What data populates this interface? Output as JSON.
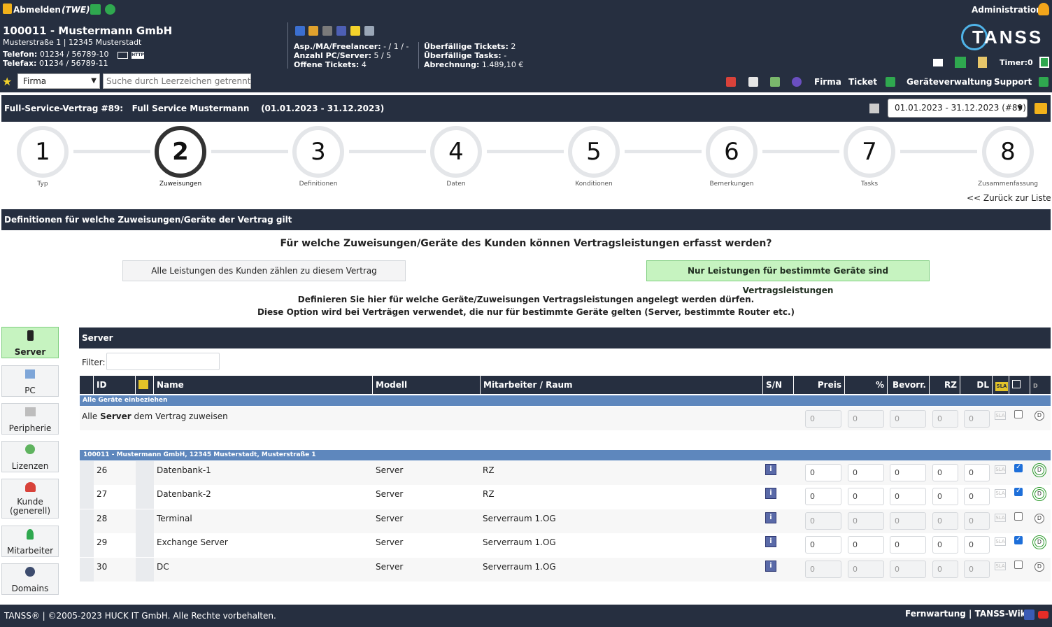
{
  "topbar": {
    "logout_label": "Abmelden",
    "user_short": "(TWE)",
    "admin_label": "Administration"
  },
  "customer": {
    "title": "100011 - Mustermann GmbH",
    "address": "Musterstraße 1 | 12345 Musterstadt",
    "phone_label": "Telefon:",
    "phone": "01234 / 56789-10",
    "fax_label": "Telefax:",
    "fax": "01234 / 56789-11",
    "asp_label": "Asp./MA/Freelancer:",
    "asp_value": "- / 1 / -",
    "pc_label": "Anzahl PC/Server:",
    "pc_value": "5 / 5",
    "tickets_label": "Offene Tickets:",
    "tickets_value": "4",
    "overdue_tickets_label": "Überfällige Tickets:",
    "overdue_tickets_value": "2",
    "overdue_tasks_label": "Überfällige Tasks:",
    "overdue_tasks_value": "-",
    "billing_label": "Abrechnung:",
    "billing_value": "1.489,10 €",
    "timer_label": "Timer:",
    "timer_value": "0",
    "logo_text": "TANSS"
  },
  "nav": {
    "select_value": "Firma",
    "search_placeholder": "Suche durch Leerzeichen getrennt",
    "menu": [
      "Firma",
      "Ticket",
      "Geräteverwaltung",
      "Support"
    ]
  },
  "contract": {
    "title": "Full-Service-Vertrag #89:   Full Service Mustermann    (01.01.2023 - 31.12.2023)",
    "period_select": "01.01.2023 - 31.12.2023 (#89)"
  },
  "steps": [
    {
      "num": "1",
      "label": "Typ"
    },
    {
      "num": "2",
      "label": "Zuweisungen"
    },
    {
      "num": "3",
      "label": "Definitionen"
    },
    {
      "num": "4",
      "label": "Daten"
    },
    {
      "num": "5",
      "label": "Konditionen"
    },
    {
      "num": "6",
      "label": "Bemerkungen"
    },
    {
      "num": "7",
      "label": "Tasks"
    },
    {
      "num": "8",
      "label": "Zusammenfassung"
    }
  ],
  "back_link": "<< Zurück zur Liste",
  "section_title": "Definitionen für welche Zuweisungen/Geräte der Vertrag gilt",
  "question": "Für welche Zuweisungen/Geräte des Kunden können Vertragsleistungen erfasst werden?",
  "option_all": "Alle Leistungen des Kunden zählen zu diesem Vertrag",
  "option_specific": "Nur Leistungen für bestimmte Geräte sind Vertragsleistungen",
  "hint_line1": "Definieren Sie hier für welche Geräte/Zuweisungen Vertragsleistungen angelegt werden dürfen.",
  "hint_line2": "Diese Option wird bei Verträgen verwendet, die nur für bestimmte Geräte gelten (Server, bestimmte Router etc.)",
  "sidebar": [
    {
      "label": "Server",
      "icon": "server-icon"
    },
    {
      "label": "PC",
      "icon": "pc-icon"
    },
    {
      "label": "Peripherie",
      "icon": "printer-icon"
    },
    {
      "label": "Lizenzen",
      "icon": "license-icon"
    },
    {
      "label": "Kunde (generell)",
      "icon": "customer-icon"
    },
    {
      "label": "Mitarbeiter",
      "icon": "employee-icon"
    },
    {
      "label": "Domains",
      "icon": "domain-icon"
    }
  ],
  "panel": {
    "title": "Server",
    "filter_label": "Filter:",
    "columns": [
      "ID",
      "Name",
      "Modell",
      "Mitarbeiter / Raum",
      "S/N",
      "Preis",
      "%",
      "Bevorr.",
      "RZ",
      "DL"
    ],
    "group_all": "Alle Geräte einbeziehen",
    "all_row_prefix": "Alle",
    "all_row_bold": "Server",
    "all_row_suffix": "dem Vertrag zuweisen",
    "group_customer": "100011 - Mustermann GmbH, 12345 Musterstadt, Musterstraße 1",
    "sla_label": "SLA",
    "default_value": "0",
    "rows": [
      {
        "id": "26",
        "name": "Datenbank-1",
        "model": "Server",
        "room": "RZ",
        "checked": true
      },
      {
        "id": "27",
        "name": "Datenbank-2",
        "model": "Server",
        "room": "RZ",
        "checked": true
      },
      {
        "id": "28",
        "name": "Terminal",
        "model": "Server",
        "room": "Serverraum 1.OG",
        "checked": false
      },
      {
        "id": "29",
        "name": "Exchange Server",
        "model": "Server",
        "room": "Serverraum 1.OG",
        "checked": true
      },
      {
        "id": "30",
        "name": "DC",
        "model": "Server",
        "room": "Serverraum 1.OG",
        "checked": false
      }
    ]
  },
  "footer": {
    "copyright": "TANSS® | ©2005-2023 HUCK IT GmbH. Alle Rechte vorbehalten.",
    "links": "Fernwartung | TANSS-Wiki"
  }
}
